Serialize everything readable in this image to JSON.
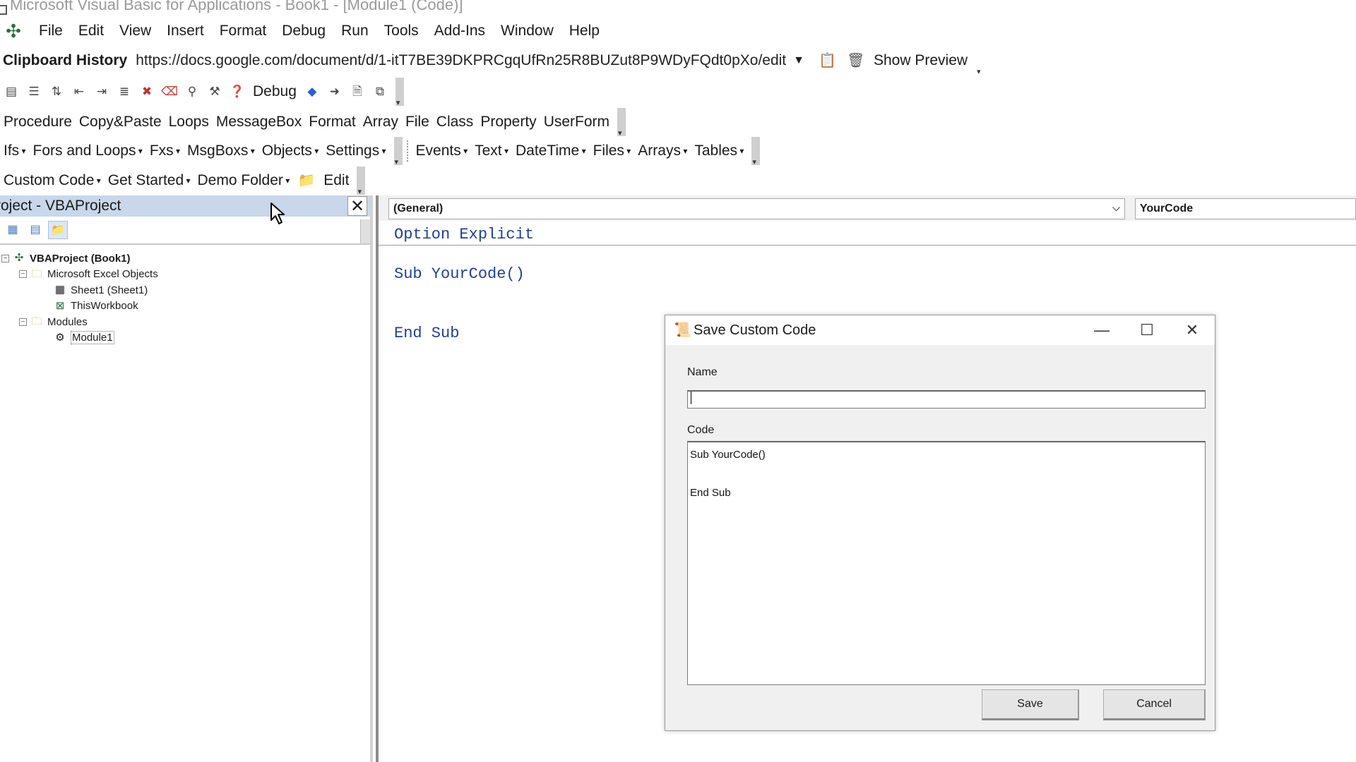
{
  "window": {
    "title": "Microsoft Visual Basic for Applications - Book1 - [Module1 (Code)]"
  },
  "menu": {
    "items": [
      "File",
      "Edit",
      "View",
      "Insert",
      "Format",
      "Debug",
      "Run",
      "Tools",
      "Add-Ins",
      "Window",
      "Help"
    ]
  },
  "clipboard_bar": {
    "label": "Clipboard History",
    "url": "https://docs.google.com/document/d/1-itT7BE39DKPRCgqUfRn25R8BUZut8P9WDyFQdt0pXo/edit",
    "show_preview": "Show Preview"
  },
  "edit_toolbar": {
    "debug_label": "Debug"
  },
  "snippets_row1": [
    "Procedure",
    "Copy&Paste",
    "Loops",
    "MessageBox",
    "Format",
    "Array",
    "File",
    "Class",
    "Property",
    "UserForm"
  ],
  "snippets_row2_left": [
    "Ifs",
    "Fors and Loops",
    "Fxs",
    "MsgBoxs",
    "Objects",
    "Settings"
  ],
  "snippets_row2_right": [
    "Events",
    "Text",
    "DateTime",
    "Files",
    "Arrays",
    "Tables"
  ],
  "snippets_row3": {
    "custom_code": "Custom Code",
    "get_started": "Get Started",
    "demo_folder": "Demo Folder",
    "edit": "Edit"
  },
  "project_pane": {
    "title": "roject - VBAProject",
    "tree": {
      "root": "VBAProject (Book1)",
      "excel_objects": "Microsoft Excel Objects",
      "sheet1": "Sheet1 (Sheet1)",
      "thisworkbook": "ThisWorkbook",
      "modules": "Modules",
      "module1": "Module1"
    }
  },
  "code_window": {
    "object_combo": "(General)",
    "proc_combo": "YourCode",
    "lines": {
      "option": "Option Explicit",
      "sub": "Sub YourCode()",
      "end": "End Sub"
    }
  },
  "dialog": {
    "title": "Save Custom Code",
    "name_label": "Name",
    "name_value": "",
    "code_label": "Code",
    "code_value": "Sub YourCode()\n\nEnd Sub",
    "save": "Save",
    "cancel": "Cancel"
  },
  "colors": {
    "project_header": "#c8d7ea",
    "code_keyword": "#1f3f99"
  }
}
